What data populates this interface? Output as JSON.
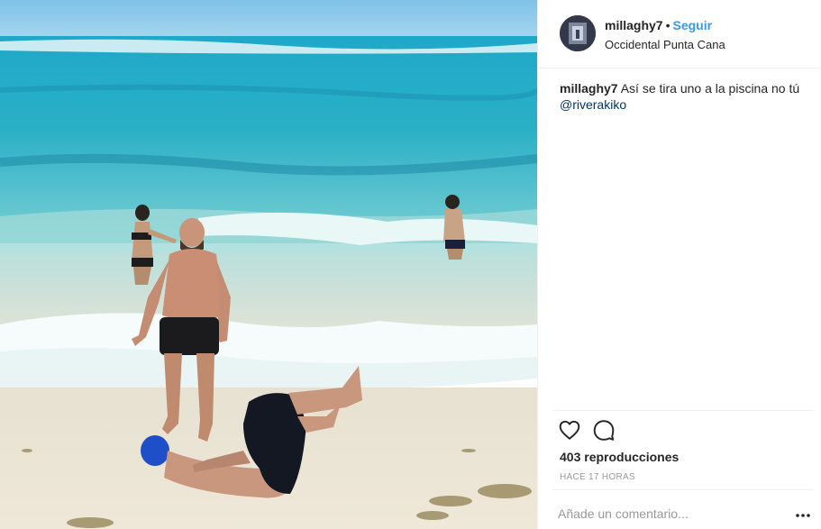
{
  "post": {
    "username": "millaghy7",
    "separator": "•",
    "follow_label": "Seguir",
    "location": "Occidental Punta Cana",
    "caption_text": " Así se tira uno a la piscina no tú ",
    "mention": "@riverakiko",
    "views_text": "403 reproducciones",
    "timestamp": "HACE 17 HORAS",
    "comment_placeholder": "Añade un comentario..."
  },
  "icons": {
    "like": "heart-icon",
    "comment": "comment-bubble-icon",
    "more": "more-options-icon"
  },
  "colors": {
    "link_blue": "#3897f0",
    "mention_blue": "#003569",
    "muted_gray": "#999999",
    "divider": "#efefef"
  }
}
